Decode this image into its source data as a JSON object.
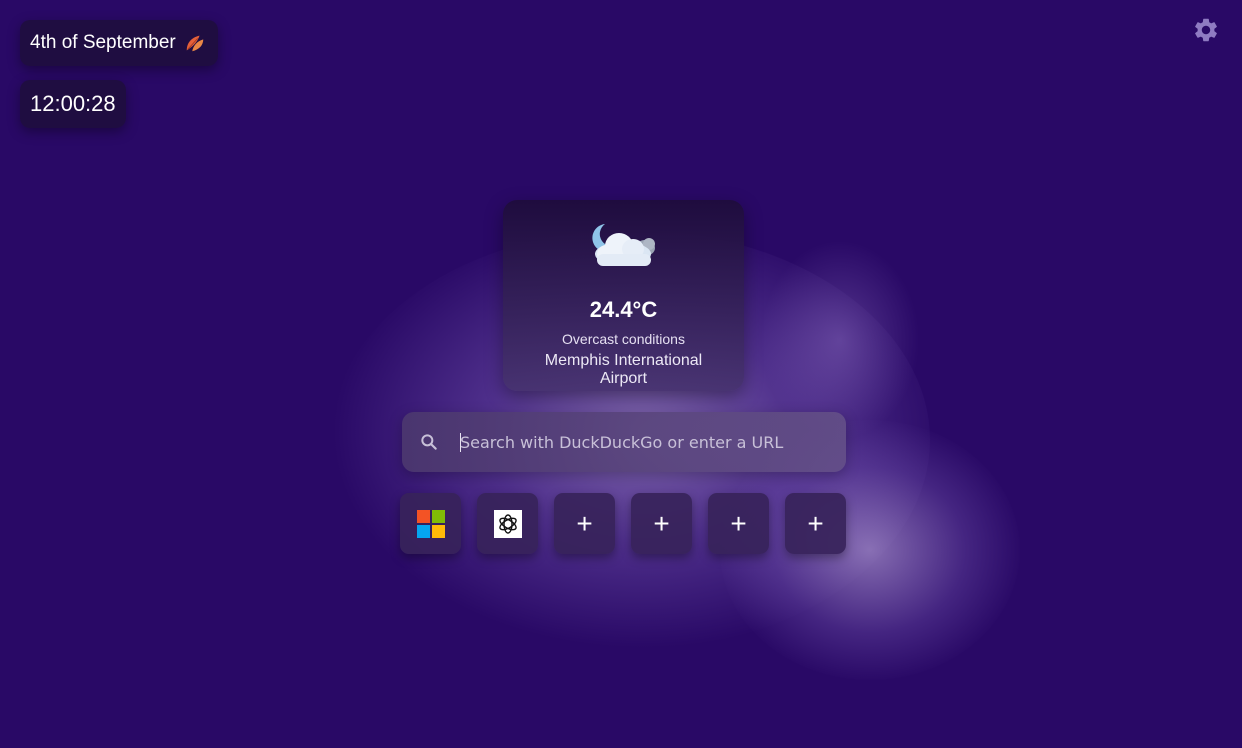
{
  "header": {
    "date": "4th of September",
    "time": "12:00:28"
  },
  "icons": {
    "date": "autumn-leaf-icon",
    "settings": "gear-icon",
    "weather": "moon-cloud-icon",
    "search": "search-icon"
  },
  "weather": {
    "temperature": "24.4°C",
    "conditions": "Overcast conditions",
    "location": "Memphis International Airport"
  },
  "search": {
    "placeholder": "Search with DuckDuckGo or enter a URL",
    "value": ""
  },
  "shortcuts": [
    {
      "icon": "microsoft-logo-icon",
      "label": ""
    },
    {
      "icon": "openai-logo-icon",
      "label": ""
    },
    {
      "icon": "plus-icon",
      "label": "+"
    },
    {
      "icon": "plus-icon",
      "label": "+"
    },
    {
      "icon": "plus-icon",
      "label": "+"
    },
    {
      "icon": "plus-icon",
      "label": "+"
    }
  ],
  "colors": {
    "background": "#290966",
    "card": "#1e0e3c",
    "accent_glow": "#c8b4eb",
    "settings_icon": "#8f7bc2"
  }
}
